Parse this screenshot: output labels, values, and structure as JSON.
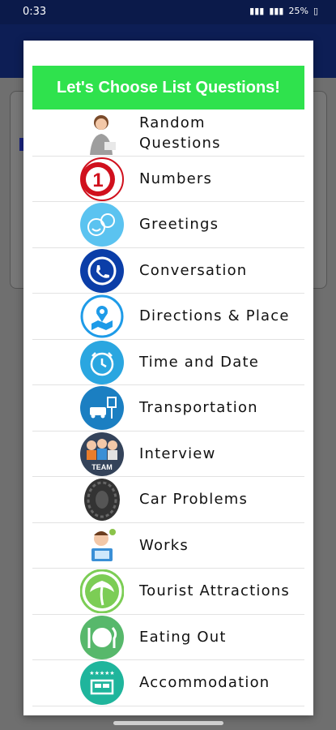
{
  "status_bar": {
    "time": "0:33",
    "battery": "25%"
  },
  "dialog": {
    "title": "Let's Choose List Questions!",
    "items": [
      {
        "label": "Random\nQuestions",
        "icon": "woman-avatar-icon",
        "color": "#f5d9c4"
      },
      {
        "label": "Numbers",
        "icon": "number-one-icon",
        "color": "#d0101d"
      },
      {
        "label": "Greetings",
        "icon": "chat-smile-icon",
        "color": "#5bc3f0"
      },
      {
        "label": "Conversation",
        "icon": "phone-call-icon",
        "color": "#0b3ea8"
      },
      {
        "label": "Directions & Place",
        "icon": "map-pin-icon",
        "color": "#1e9be8"
      },
      {
        "label": "Time and Date",
        "icon": "alarm-clock-icon",
        "color": "#2aa6e0"
      },
      {
        "label": "Transportation",
        "icon": "car-sign-icon",
        "color": "#1b7fc2"
      },
      {
        "label": "Interview",
        "icon": "team-icon",
        "color": "#34435a"
      },
      {
        "label": "Car Problems",
        "icon": "tire-icon",
        "color": "#444444"
      },
      {
        "label": "Works",
        "icon": "worker-laptop-icon",
        "color": "#f2f2f2"
      },
      {
        "label": "Tourist Attractions",
        "icon": "palm-tree-icon",
        "color": "#7ccd55"
      },
      {
        "label": "Eating Out",
        "icon": "plate-cutlery-icon",
        "color": "#57b86b"
      },
      {
        "label": "Accommodation",
        "icon": "hotel-bed-icon",
        "color": "#1fb59c"
      }
    ]
  }
}
